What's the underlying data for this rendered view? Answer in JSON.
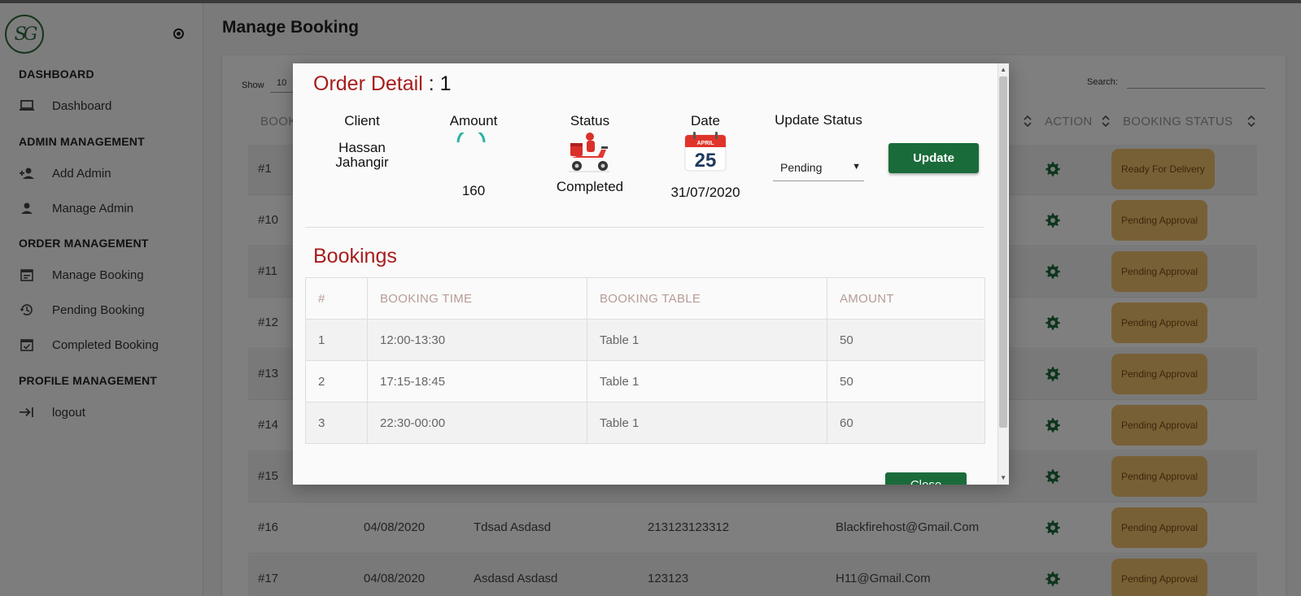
{
  "sidebar": {
    "logo_text": "SG",
    "sections": [
      {
        "title": "DASHBOARD",
        "items": [
          {
            "label": "Dashboard",
            "icon": "laptop-icon"
          }
        ]
      },
      {
        "title": "ADMIN MANAGEMENT",
        "items": [
          {
            "label": "Add Admin",
            "icon": "person-add-icon"
          },
          {
            "label": "Manage Admin",
            "icon": "person-icon"
          }
        ]
      },
      {
        "title": "ORDER MANAGEMENT",
        "items": [
          {
            "label": "Manage Booking",
            "icon": "calendar-icon"
          },
          {
            "label": "Pending Booking",
            "icon": "history-icon"
          },
          {
            "label": "Completed Booking",
            "icon": "calendar-check-icon"
          }
        ]
      },
      {
        "title": "PROFILE MANAGEMENT",
        "items": [
          {
            "label": "logout",
            "icon": "logout-icon"
          }
        ]
      }
    ]
  },
  "page": {
    "title": "Manage Booking",
    "show_label": "Show",
    "show_value": "10",
    "search_label": "Search:",
    "search_value": ""
  },
  "table": {
    "headers": {
      "booking": "BOOKI",
      "action": "ACTION",
      "booking_status": "BOOKING STATUS"
    },
    "rows": [
      {
        "id": "#1",
        "date": "",
        "name": "",
        "phone": "",
        "email": "",
        "status": "Ready For Delivery"
      },
      {
        "id": "#10",
        "date": "",
        "name": "",
        "phone": "",
        "email": "",
        "status": "Pending Approval"
      },
      {
        "id": "#11",
        "date": "",
        "name": "",
        "phone": "",
        "email": "",
        "status": "Pending Approval"
      },
      {
        "id": "#12",
        "date": "",
        "name": "",
        "phone": "",
        "email": "",
        "status": "Pending Approval"
      },
      {
        "id": "#13",
        "date": "",
        "name": "",
        "phone": "",
        "email": "",
        "status": "Pending Approval"
      },
      {
        "id": "#14",
        "date": "",
        "name": "",
        "phone": "",
        "email": "",
        "status": "Pending Approval"
      },
      {
        "id": "#15",
        "date": "",
        "name": "",
        "phone": "",
        "email": "",
        "status": "Pending Approval"
      },
      {
        "id": "#16",
        "date": "04/08/2020",
        "name": "Tdsad Asdasd",
        "phone": "213123123312",
        "email": "Blackfirehost@Gmail.Com",
        "status": "Pending Approval"
      },
      {
        "id": "#17",
        "date": "04/08/2020",
        "name": "Asdasd Asdasd",
        "phone": "123123",
        "email": "H11@Gmail.Com",
        "status": "Pending Approval"
      }
    ]
  },
  "modal": {
    "title": "Order Detail",
    "title_sep": " : ",
    "order_number": "1",
    "client_label": "Client",
    "client_value": "Hassan Jahangir",
    "amount_label": "Amount",
    "amount_value": "160",
    "status_label": "Status",
    "status_value": "Completed",
    "date_label": "Date",
    "date_value": "31/07/2020",
    "calendar_month": "APRIL",
    "calendar_day": "25",
    "update_status_label": "Update Status",
    "update_status_value": "Pending",
    "update_button": "Update",
    "bookings_title": "Bookings",
    "bookings_headers": [
      "#",
      "BOOKING TIME",
      "BOOKING TABLE",
      "AMOUNT"
    ],
    "bookings": [
      {
        "num": "1",
        "time": "12:00-13:30",
        "table": "Table 1",
        "amount": "50"
      },
      {
        "num": "2",
        "time": "17:15-18:45",
        "table": "Table 1",
        "amount": "50"
      },
      {
        "num": "3",
        "time": "22:30-00:00",
        "table": "Table 1",
        "amount": "60"
      }
    ],
    "close_button": "Close"
  },
  "colors": {
    "accent_green": "#1a6b3a",
    "accent_red": "#a71d1d",
    "badge": "#f0c06d"
  }
}
